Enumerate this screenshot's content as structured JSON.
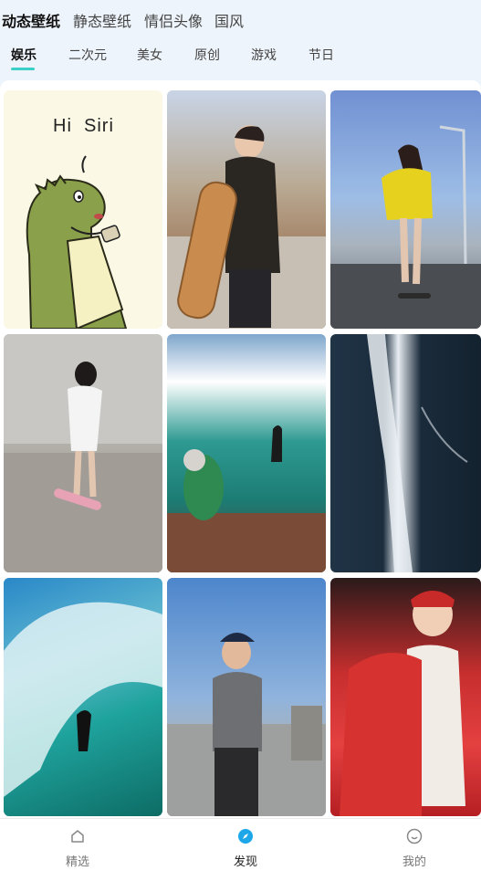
{
  "top_tabs": [
    {
      "label": "动态壁纸",
      "active": true
    },
    {
      "label": "静态壁纸",
      "active": false
    },
    {
      "label": "情侣头像",
      "active": false
    },
    {
      "label": "国风",
      "active": false
    }
  ],
  "sub_tabs": [
    {
      "label": "娱乐",
      "active": true
    },
    {
      "label": "二次元",
      "active": false
    },
    {
      "label": "美女",
      "active": false
    },
    {
      "label": "原创",
      "active": false
    },
    {
      "label": "游戏",
      "active": false
    },
    {
      "label": "节日",
      "active": false
    }
  ],
  "tiles": [
    {
      "caption": "Hi  Siri"
    },
    {
      "caption": ""
    },
    {
      "caption": ""
    },
    {
      "caption": ""
    },
    {
      "caption": ""
    },
    {
      "caption": ""
    },
    {
      "caption": ""
    },
    {
      "caption": ""
    },
    {
      "caption": ""
    }
  ],
  "bottom_nav": [
    {
      "label": "精选",
      "icon": "home-icon",
      "active": false
    },
    {
      "label": "发现",
      "icon": "compass-icon",
      "active": true
    },
    {
      "label": "我的",
      "icon": "smile-icon",
      "active": false
    }
  ],
  "colors": {
    "accent": "#3ad0c7",
    "active_nav_icon": "#1ea7e8"
  }
}
